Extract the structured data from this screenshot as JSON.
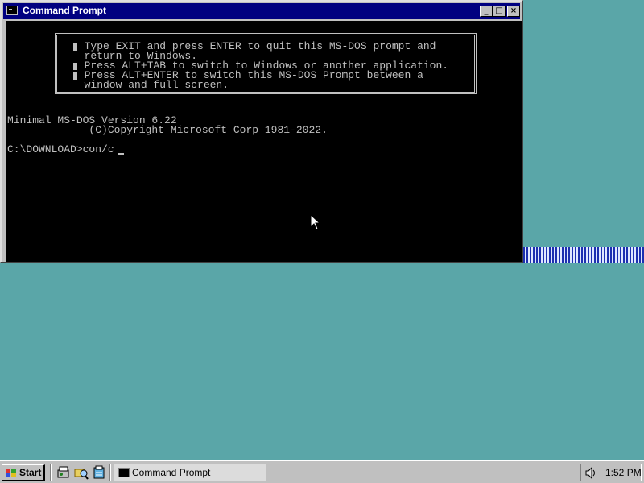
{
  "window": {
    "title": "Command Prompt",
    "controls": {
      "minimize": "_",
      "maximize": "□",
      "close": "×"
    }
  },
  "console": {
    "banner_lines": [
      "  Type EXIT and press ENTER to quit this MS-DOS prompt and",
      "  return to Windows.",
      "  Press ALT+TAB to switch to Windows or another application.",
      "  Press ALT+ENTER to switch this MS-DOS Prompt between a",
      "  window and full screen."
    ],
    "version_line": "Minimal MS-DOS Version 6.22",
    "copyright_line": "             (C)Copyright Microsoft Corp 1981-2022.",
    "prompt_line": "C:\\DOWNLOAD>con/c",
    "colors": {
      "background": "#000000",
      "text": "#c0c0c0"
    }
  },
  "taskbar": {
    "start_label": "Start",
    "quick_launch": [
      "explorer-icon",
      "folder-search-icon",
      "notepad-icon"
    ],
    "active_task": "Command Prompt",
    "clock": "1:52 PM",
    "tray_icons": [
      "volume-icon"
    ]
  },
  "desktop": {
    "background_color": "#5aa6a8"
  }
}
